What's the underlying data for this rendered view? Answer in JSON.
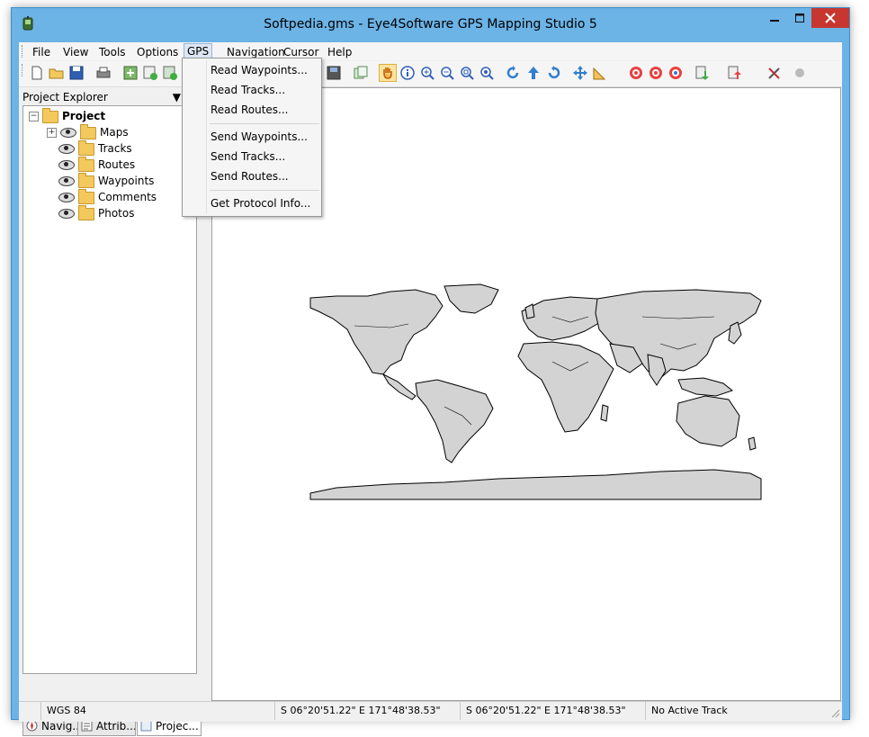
{
  "window": {
    "title": "Softpedia.gms - Eye4Software GPS Mapping Studio 5",
    "icons": {
      "app": "gps-app-icon",
      "minimize": "minimize-icon",
      "maximize": "maximize-icon",
      "close": "close-icon"
    }
  },
  "menubar": {
    "items": [
      {
        "label": "File"
      },
      {
        "label": "View"
      },
      {
        "label": "Tools"
      },
      {
        "label": "Options"
      },
      {
        "label": "GPS",
        "active": true
      },
      {
        "label": "Navigation"
      },
      {
        "label": "Cursor"
      },
      {
        "label": "Help"
      }
    ]
  },
  "gps_menu": {
    "items": [
      {
        "label": "Read Waypoints..."
      },
      {
        "label": "Read Tracks..."
      },
      {
        "label": "Read Routes..."
      },
      {
        "label": "Send Waypoints..."
      },
      {
        "label": "Send Tracks..."
      },
      {
        "label": "Send Routes..."
      },
      {
        "label": "Get Protocol Info..."
      }
    ]
  },
  "toolbar": {
    "buttons": [
      "new-icon",
      "open-icon",
      "save-icon",
      "print-icon",
      "add-map-icon",
      "add-layer-icon",
      "add-item-icon",
      "map-save-icon",
      "copy-icon",
      "pan-icon",
      "info-icon",
      "zoom-in-icon",
      "zoom-out-icon",
      "zoom-window-icon",
      "zoom-extent-icon",
      "rotate-left-icon",
      "up-arrow-icon",
      "rotate-right-icon",
      "move-icon",
      "measure-icon",
      "target-red-icon",
      "target-center-icon",
      "target-track-icon",
      "download-icon",
      "upload-icon",
      "settings-tools-icon",
      "record-icon"
    ]
  },
  "explorer": {
    "title": "Project Explorer",
    "root": "Project",
    "children": [
      {
        "label": "Maps",
        "expandable": true
      },
      {
        "label": "Tracks"
      },
      {
        "label": "Routes"
      },
      {
        "label": "Waypoints"
      },
      {
        "label": "Comments"
      },
      {
        "label": "Photos"
      }
    ],
    "tabs": [
      {
        "label": "Navig..."
      },
      {
        "label": "Attrib..."
      },
      {
        "label": "Projec...",
        "active": true
      }
    ]
  },
  "statusbar": {
    "datum": "WGS 84",
    "position1": "S 06°20'51.22\" E 171°48'38.53\"",
    "position2": "S 06°20'51.22\" E 171°48'38.53\"",
    "track": "No Active Track"
  },
  "colors": {
    "frame": "#6cb3e6",
    "close": "#c7372f",
    "land": "#d3d3d3"
  }
}
